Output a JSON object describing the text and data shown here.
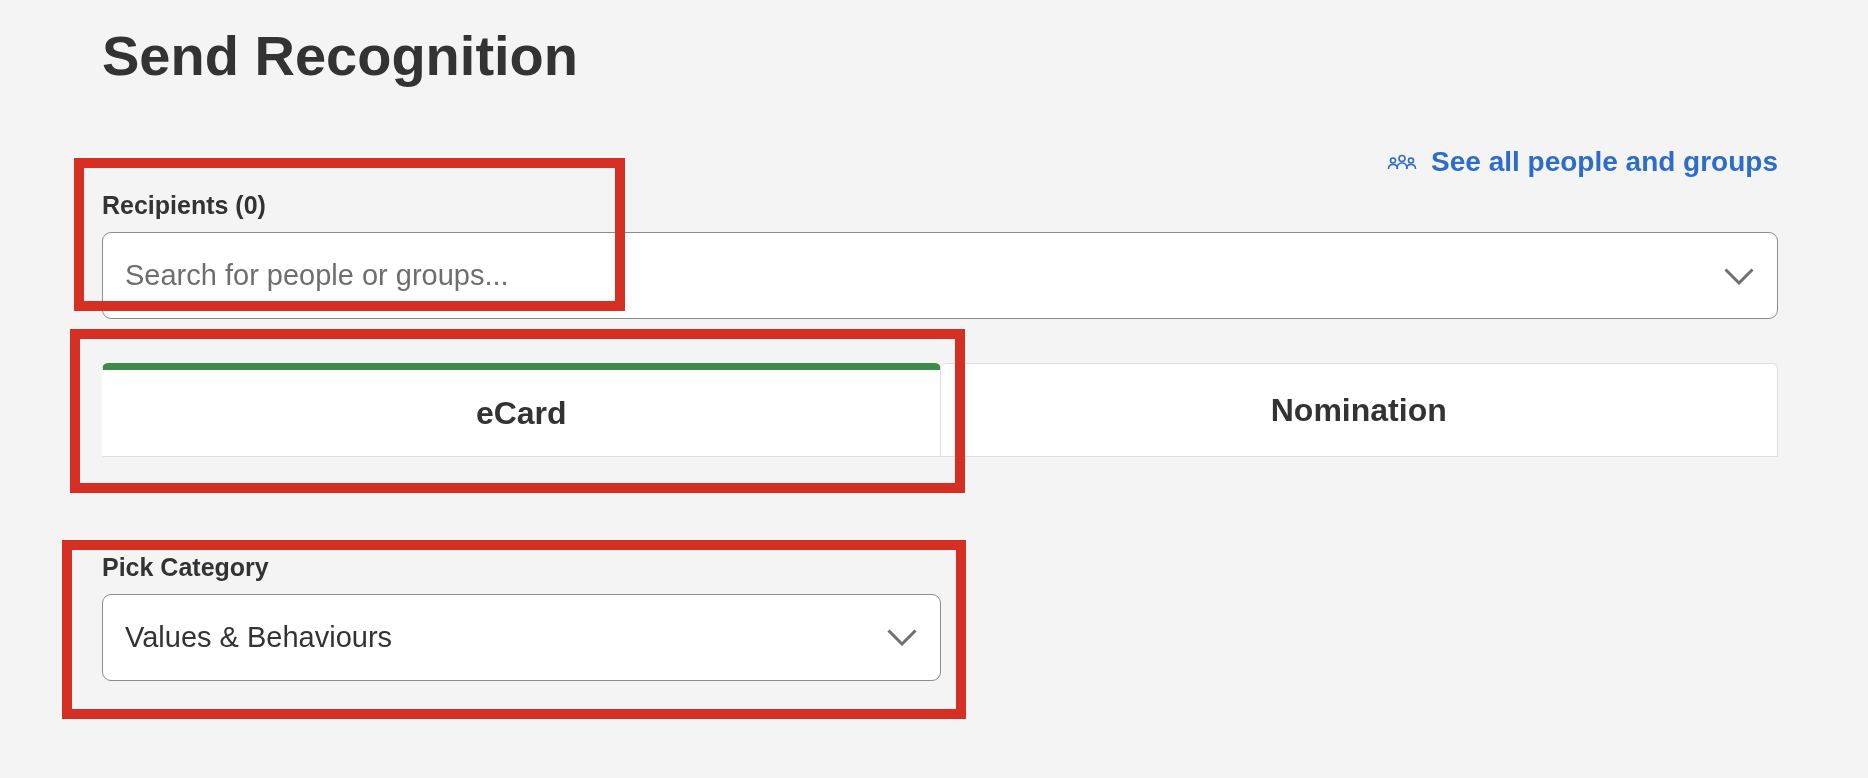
{
  "page": {
    "title": "Send Recognition"
  },
  "people_link": {
    "label": "See all people and groups"
  },
  "recipients": {
    "label": "Recipients (0)",
    "placeholder": "Search for people or groups...",
    "highlighted": true
  },
  "tabs": {
    "highlighted": true,
    "items": [
      {
        "label": "eCard",
        "selected": true
      },
      {
        "label": "Nomination",
        "selected": false
      }
    ]
  },
  "category": {
    "label": "Pick Category",
    "value": "Values & Behaviours",
    "highlighted": true
  }
}
